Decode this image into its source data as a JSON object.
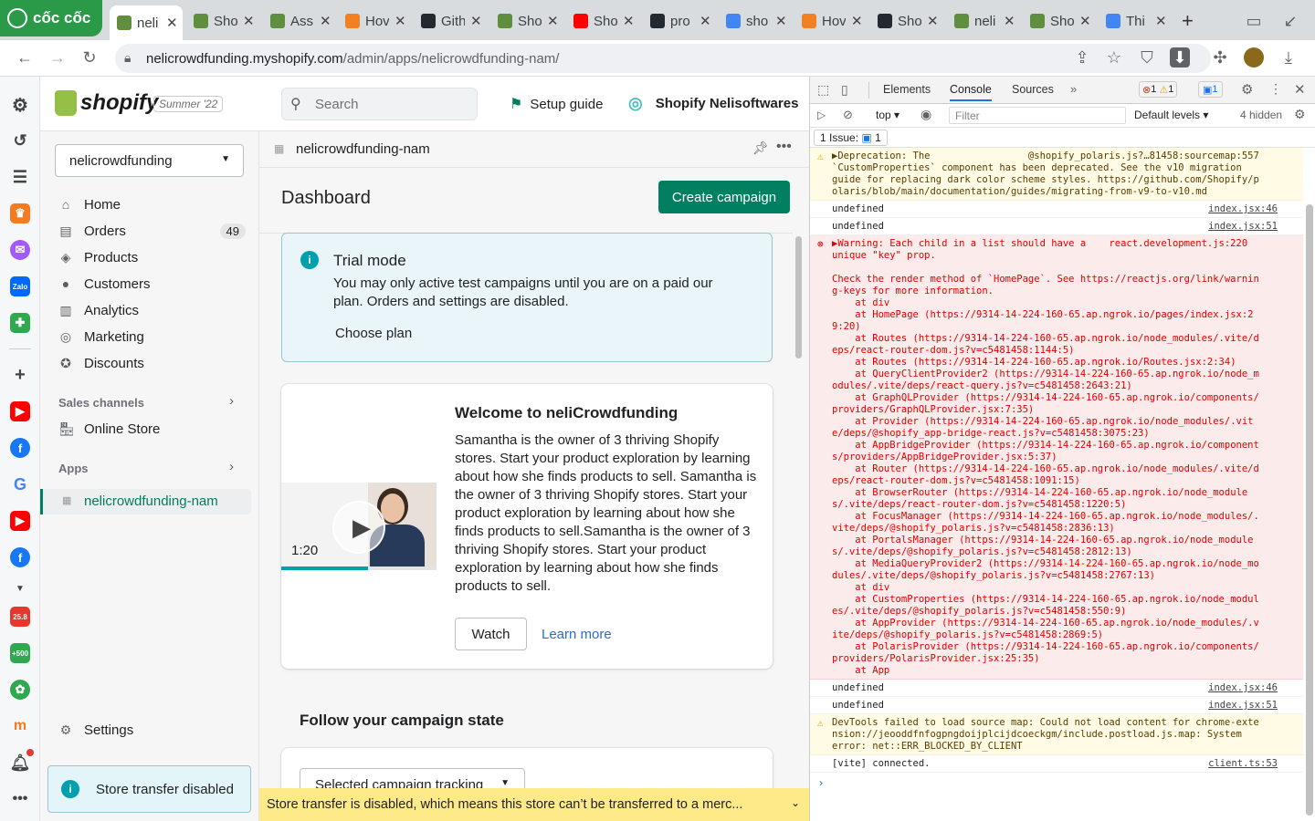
{
  "browser": {
    "logo": "cốc cốc",
    "tabs": [
      {
        "label": "neli",
        "color": "#5e8e3e",
        "active": true
      },
      {
        "label": "Sho",
        "color": "#5e8e3e"
      },
      {
        "label": "Ass",
        "color": "#5e8e3e"
      },
      {
        "label": "Hov",
        "color": "#f48024"
      },
      {
        "label": "Gith",
        "color": "#24292f"
      },
      {
        "label": "Sho",
        "color": "#5e8e3e"
      },
      {
        "label": "Sho",
        "color": "#ff0000"
      },
      {
        "label": "pro",
        "color": "#24292f"
      },
      {
        "label": "sho",
        "color": "#4285f4"
      },
      {
        "label": "Hov",
        "color": "#f48024"
      },
      {
        "label": "Sho",
        "color": "#24292f"
      },
      {
        "label": "neli",
        "color": "#5e8e3e"
      },
      {
        "label": "Sho",
        "color": "#5e8e3e"
      },
      {
        "label": "Thi",
        "color": "#4285f4"
      }
    ],
    "url_host": "nelicrowdfunding.myshopify.com",
    "url_path": "/admin/apps/nelicrowdfunding-nam/"
  },
  "shopify": {
    "brand": "shopify",
    "edition": "Summer '22",
    "search_placeholder": "Search",
    "setup_guide": "Setup guide",
    "store_name": "Shopify Nelisoftwares",
    "store_select": "nelicrowdfunding",
    "nav": [
      {
        "label": "Home",
        "icon": "home-icon"
      },
      {
        "label": "Orders",
        "icon": "orders-icon",
        "badge": "49"
      },
      {
        "label": "Products",
        "icon": "tag-icon"
      },
      {
        "label": "Customers",
        "icon": "person-icon"
      },
      {
        "label": "Analytics",
        "icon": "bar-chart-icon"
      },
      {
        "label": "Marketing",
        "icon": "target-icon"
      },
      {
        "label": "Discounts",
        "icon": "discount-icon"
      }
    ],
    "sales_channels": "Sales channels",
    "online_store": "Online Store",
    "apps": "Apps",
    "app_item": "nelicrowdfunding-nam",
    "settings": "Settings",
    "store_transfer": "Store transfer disabled",
    "app_title": "nelicrowdfunding-nam",
    "page_title": "Dashboard",
    "create_campaign": "Create campaign",
    "trial_title": "Trial mode",
    "trial_text": "You may only active test campaigns until you are on a paid our plan. Orders and settings are disabled.",
    "choose_plan": "Choose plan",
    "welcome_title": "Welcome to neliCrowdfunding",
    "welcome_text": "Samantha is the owner of 3 thriving Shopify stores. Start your product exploration by learning about how she finds products to sell. Samantha is the owner of 3 thriving Shopify stores. Start your product exploration by learning about how she finds products to sell.Samantha is the owner of 3 thriving Shopify stores. Start your product exploration by learning about how she finds products to sell.",
    "video_duration": "1:20",
    "video_progress": 0.56,
    "watch": "Watch",
    "learn_more": "Learn more",
    "follow_title": "Follow your campaign state",
    "select_tracking": "Selected campaign tracking",
    "banner_text": "Store transfer is disabled, which means this store can’t be transferred to a merc..."
  },
  "devtools": {
    "tabs": [
      "Elements",
      "Console",
      "Sources"
    ],
    "errors": "1",
    "warnings": "1",
    "issues_count": "1",
    "context": "top",
    "filter_placeholder": "Filter",
    "levels": "Default levels",
    "hidden": "4 hidden",
    "issues_label": "1 Issue:",
    "issues_num": "1",
    "rows": [
      {
        "type": "warn",
        "msg": "▶Deprecation: The                 @shopify_polaris.js?…81458:sourcemap:557\n`CustomProperties` component has been deprecated. See the v10 migration\nguide for replacing dark color scheme styles. https://github.com/Shopify/p\nolaris/blob/main/documentation/guides/migrating-from-v9-to-v10.md",
        "src": ""
      },
      {
        "type": "log",
        "msg": "undefined",
        "src": "index.jsx:46"
      },
      {
        "type": "log",
        "msg": "undefined",
        "src": "index.jsx:51"
      },
      {
        "type": "error",
        "msg": "▶Warning: Each child in a list should have a    react.development.js:220\nunique \"key\" prop.\n\nCheck the render method of `HomePage`. See https://reactjs.org/link/warnin\ng-keys for more information.\n    at div\n    at HomePage (https://9314-14-224-160-65.ap.ngrok.io/pages/index.jsx:2\n9:20)\n    at Routes (https://9314-14-224-160-65.ap.ngrok.io/node_modules/.vite/d\neps/react-router-dom.js?v=c5481458:1144:5)\n    at Routes (https://9314-14-224-160-65.ap.ngrok.io/Routes.jsx:2:34)\n    at QueryClientProvider2 (https://9314-14-224-160-65.ap.ngrok.io/node_m\nodules/.vite/deps/react-query.js?v=c5481458:2643:21)\n    at GraphQLProvider (https://9314-14-224-160-65.ap.ngrok.io/components/\nproviders/GraphQLProvider.jsx:7:35)\n    at Provider (https://9314-14-224-160-65.ap.ngrok.io/node_modules/.vit\ne/deps/@shopify_app-bridge-react.js?v=c5481458:3075:23)\n    at AppBridgeProvider (https://9314-14-224-160-65.ap.ngrok.io/component\ns/providers/AppBridgeProvider.jsx:5:37)\n    at Router (https://9314-14-224-160-65.ap.ngrok.io/node_modules/.vite/d\neps/react-router-dom.js?v=c5481458:1091:15)\n    at BrowserRouter (https://9314-14-224-160-65.ap.ngrok.io/node_module\ns/.vite/deps/react-router-dom.js?v=c5481458:1220:5)\n    at FocusManager (https://9314-14-224-160-65.ap.ngrok.io/node_modules/.\nvite/deps/@shopify_polaris.js?v=c5481458:2836:13)\n    at PortalsManager (https://9314-14-224-160-65.ap.ngrok.io/node_module\ns/.vite/deps/@shopify_polaris.js?v=c5481458:2812:13)\n    at MediaQueryProvider2 (https://9314-14-224-160-65.ap.ngrok.io/node_mo\ndules/.vite/deps/@shopify_polaris.js?v=c5481458:2767:13)\n    at div\n    at CustomProperties (https://9314-14-224-160-65.ap.ngrok.io/node_modul\nes/.vite/deps/@shopify_polaris.js?v=c5481458:550:9)\n    at AppProvider (https://9314-14-224-160-65.ap.ngrok.io/node_modules/.v\nite/deps/@shopify_polaris.js?v=c5481458:2869:5)\n    at PolarisProvider (https://9314-14-224-160-65.ap.ngrok.io/components/\nproviders/PolarisProvider.jsx:25:35)\n    at App",
        "src": ""
      },
      {
        "type": "log",
        "msg": "undefined",
        "src": "index.jsx:46"
      },
      {
        "type": "log",
        "msg": "undefined",
        "src": "index.jsx:51"
      },
      {
        "type": "warn",
        "msg": "DevTools failed to load source map: Could not load content for chrome-exte\nnsion://jeooddfnfogpngdoijplcijdcoeckgm/include.postload.js.map: System\nerror: net::ERR_BLOCKED_BY_CLIENT",
        "src": ""
      },
      {
        "type": "log",
        "msg": "[vite] connected.",
        "src": "client.ts:53"
      }
    ]
  }
}
